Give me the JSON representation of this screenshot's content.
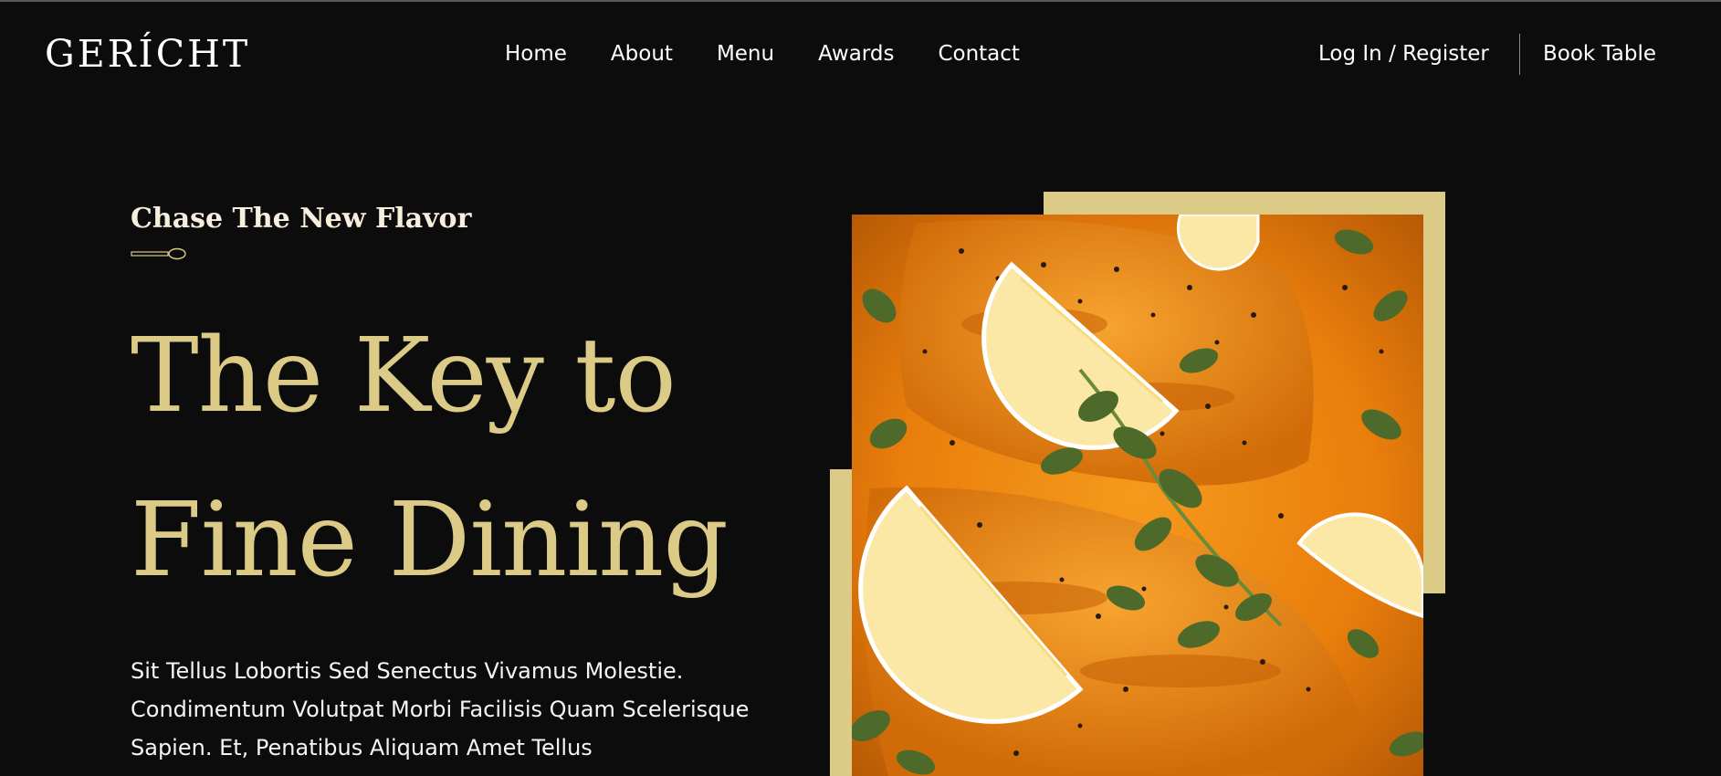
{
  "nav": {
    "logo": "GERÍCHT",
    "links": [
      "Home",
      "About",
      "Menu",
      "Awards",
      "Contact"
    ],
    "login": "Log In / Register",
    "book": "Book Table"
  },
  "hero": {
    "subtitle": "Chase The New Flavor",
    "title_line1": "The Key to",
    "title_line2": "Fine Dining",
    "paragraph": "Sit Tellus Lobortis Sed Senectus Vivamus Molestie. Condimentum Volutpat Morbi Facilisis Quam Scelerisque Sapien. Et, Penatibus Aliquam Amet Tellus"
  },
  "colors": {
    "background": "#0c0c0c",
    "accent_gold": "#dcca87",
    "text": "#ffffff"
  },
  "icons": {
    "spoon": "spoon-icon"
  }
}
